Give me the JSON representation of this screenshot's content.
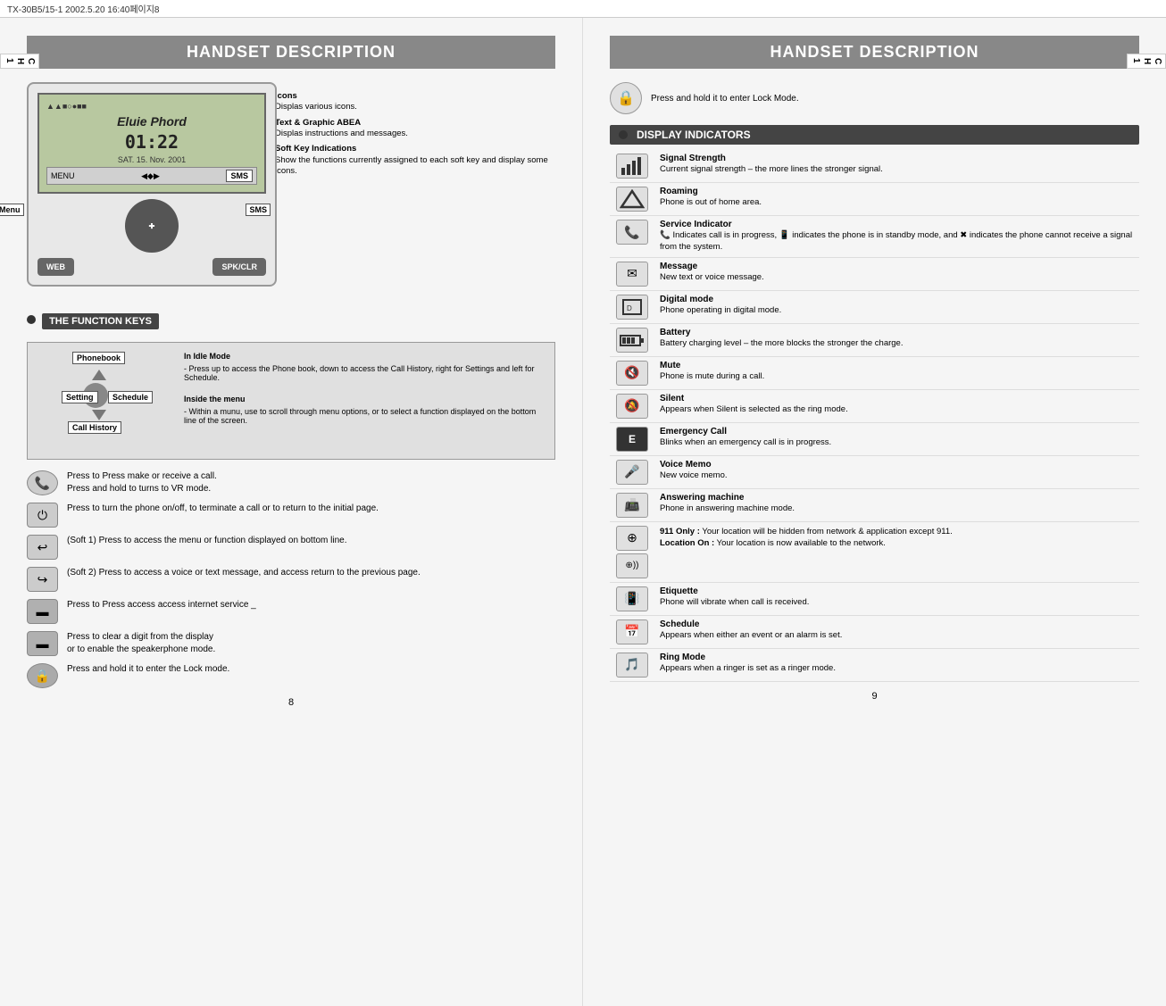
{
  "topbar": {
    "text": "TX-30B5/15-1  2002.5.20  16:40페이지8"
  },
  "left_page": {
    "title": "HANDSET DESCRIPTION",
    "ch_tab": "C\nH\n1",
    "phone": {
      "icons_text": "▲▲■○●■■",
      "name": "Eluie Phord",
      "time": "01:22",
      "date": "SAT. 15. Nov. 2001",
      "soft_keys": [
        "MENU",
        "◀◆▶",
        "SMS"
      ],
      "main_menu_label": "Main Menu",
      "sms_label": "SMS"
    },
    "annotations": [
      {
        "label": "Icons",
        "desc": "Displas various icons."
      },
      {
        "label": "Text & Graphic ABEA",
        "desc": "Displas instructions and messages."
      },
      {
        "label": "Soft Key Indications",
        "desc": "Show the functions currently assigned to each soft key and display some icons."
      }
    ],
    "function_keys_title": "THE FUNCTION KEYS",
    "nav": {
      "phonebook": "Phonebook",
      "setting": "Setting",
      "schedule": "Schedule",
      "call_history": "Call History"
    },
    "idle_mode_title": "In Idle Mode",
    "idle_mode_desc": "- Press up to access the Phone book, down to access the Call History, right for Settings and left for Schedule.",
    "inside_menu_title": "Inside the menu",
    "inside_menu_desc": "- Within a munu, use to scroll through menu options, or to select a function displayed on the bottom line of the screen.",
    "actions": [
      {
        "icon": "📞",
        "text": "Press to Press make or receive a call.\nPress and hold to turns to VR mode."
      },
      {
        "icon": "⏻",
        "text": "Press to turn the phone on/off, to terminate a call or to return to the initial page."
      },
      {
        "icon": "↩",
        "text": "(Soft 1) Press to access the menu or function displayed on bottom line."
      },
      {
        "icon": "↪",
        "text": "(Soft 2) Press to access a voice or text message, and access return to the previous page."
      },
      {
        "icon": "🌐",
        "text": "Press to Press access access internet service _"
      },
      {
        "icon": "📢",
        "text": "Press to clear a digit from the display or to enable the speakerphone mode."
      },
      {
        "icon": "🔒",
        "text": "Press and hold it to enter the Lock mode."
      }
    ],
    "page_number": "8"
  },
  "right_page": {
    "title": "HANDSET DESCRIPTION",
    "ch_tab": "C\nH\n1",
    "lock_text": "Press and hold it to enter Lock Mode.",
    "display_indicators_title": "DISPLAY INDICATORS",
    "indicators": [
      {
        "icon": "📶",
        "title": "Signal Strength",
        "desc": "Current signal strength – the more lines the stronger signal."
      },
      {
        "icon": "△",
        "title": "Roaming",
        "desc": "Phone is out of home area."
      },
      {
        "icon": "📞",
        "title": "Service Indicator",
        "desc": "🔔 Indicates call is in progress,  📞  indicates the phone is in standby mode, and  ✖  indicates the phone cannot receive a signal from the system."
      },
      {
        "icon": "✉",
        "title": "Message",
        "desc": "New text or voice message."
      },
      {
        "icon": "🔲",
        "title": "Digital mode",
        "desc": "Phone operating in digital mode."
      },
      {
        "icon": "🔋",
        "title": "Battery",
        "desc": "Battery charging level – the more blocks the stronger the charge."
      },
      {
        "icon": "🔇",
        "title": "Mute",
        "desc": "Phone is mute during a call."
      },
      {
        "icon": "🔕",
        "title": "Silent",
        "desc": "Appears when Silent is selected as the ring mode."
      },
      {
        "icon": "🆘",
        "title": "Emergency Call",
        "desc": "Blinks when an emergency call is in progress."
      },
      {
        "icon": "🎤",
        "title": "Voice Memo",
        "desc": "New  voice memo."
      },
      {
        "icon": "📠",
        "title": "Answering machine",
        "desc": "Phone in answering machine mode."
      },
      {
        "icon": "🌐",
        "title": "911 / Location",
        "desc": "911 Only : Your location will be hidden from network & application except 911.\nLocation On : Your location is now available to the network."
      },
      {
        "icon": "📳",
        "title": "Etiquette",
        "desc": "Phone will vibrate when call is received."
      },
      {
        "icon": "📅",
        "title": "Schedule",
        "desc": "Appears when either an event or an alarm is set."
      },
      {
        "icon": "🎵",
        "title": "Ring Mode",
        "desc": "Appears when a ringer is set as a ringer mode."
      }
    ],
    "page_number": "9"
  }
}
